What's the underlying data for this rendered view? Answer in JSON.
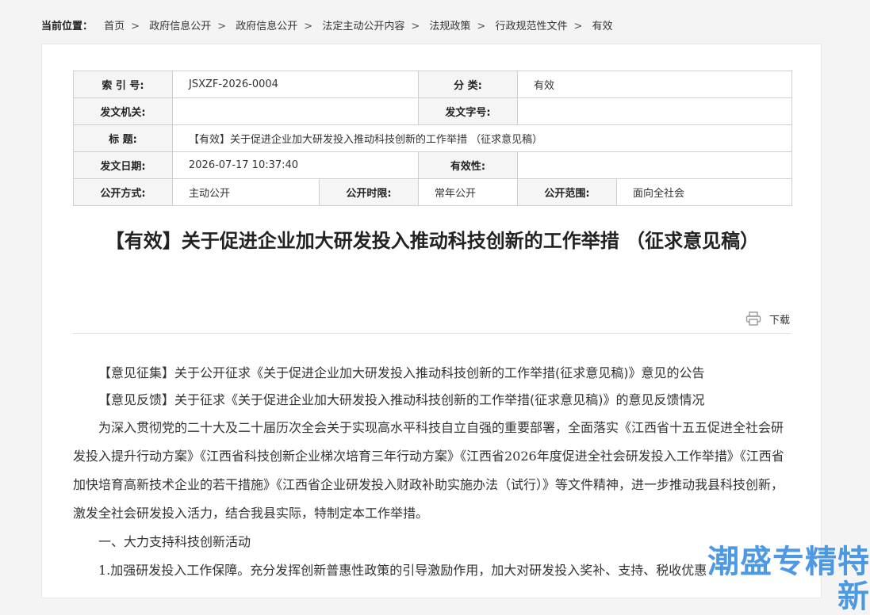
{
  "breadcrumb": {
    "label": "当前位置：",
    "items": [
      "首页",
      "政府信息公开",
      "政府信息公开",
      "法定主动公开内容",
      "法规政策",
      "行政规范性文件",
      "有效"
    ],
    "separator": ">"
  },
  "meta": {
    "index_label": "索 引 号:",
    "index_value": "JSXZF-2026-0004",
    "category_label": "分 类:",
    "category_value": "有效",
    "issuer_label": "发文机关:",
    "issuer_value": "",
    "doc_no_label": "发文字号:",
    "doc_no_value": "",
    "title_label": "标 题:",
    "title_value": "【有效】关于促进企业加大研发投入推动科技创新的工作举措 （征求意见稿）",
    "date_label": "发文日期:",
    "date_value": "2026-07-17 10:37:40",
    "validity_label": "有效性:",
    "validity_value": "",
    "open_mode_label": "公开方式:",
    "open_mode_value": "主动公开",
    "open_period_label": "公开时限:",
    "open_period_value": "常年公开",
    "open_scope_label": "公开范围:",
    "open_scope_value": "面向全社会"
  },
  "doc": {
    "title": "【有效】关于促进企业加大研发投入推动科技创新的工作举措 （征求意见稿）",
    "download_label": "下载"
  },
  "body": {
    "link1": "【意见征集】关于公开征求《关于促进企业加大研发投入推动科技创新的工作举措(征求意见稿)》意见的公告",
    "link2": "【意见反馈】关于征求《关于促进企业加大研发投入推动科技创新的工作举措(征求意见稿)》的意见反馈情况",
    "para1": "为深入贯彻党的二十大及二十届历次全会关于实现高水平科技自立自强的重要部署，全面落实《江西省十五五促进全社会研发投入提升行动方案》《江西省科技创新企业梯次培育三年行动方案》《江西省2026年度促进全社会研发投入工作举措》《江西省加快培育高新技术企业的若干措施》《江西省企业研发投入财政补助实施办法（试行）》等文件精神，进一步推动我县科技创新，激发全社会研发投入活力，结合我县实际，特制定本工作举措。",
    "heading1": "一、大力支持科技创新活动",
    "item1": "1.加强研发投入工作保障。充分发挥创新普惠性政策的引导激励作用，加大对研发投入奖补、支持、税收优惠"
  },
  "watermark": "潮盛专精特新"
}
